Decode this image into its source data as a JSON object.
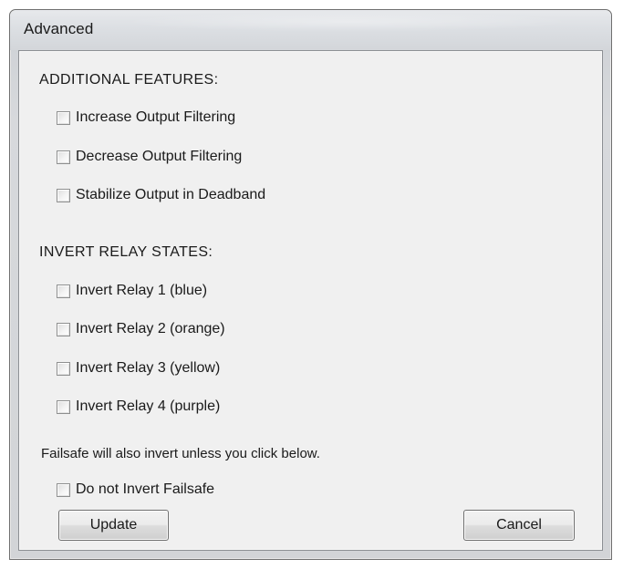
{
  "window": {
    "title": "Advanced"
  },
  "sections": {
    "additional_features": {
      "header": "ADDITIONAL FEATURES:",
      "options": [
        {
          "label": "Increase Output Filtering",
          "checked": false
        },
        {
          "label": "Decrease Output Filtering",
          "checked": false
        },
        {
          "label": "Stabilize Output in Deadband",
          "checked": false
        }
      ]
    },
    "invert_relay_states": {
      "header": "INVERT RELAY STATES:",
      "options": [
        {
          "label": "Invert Relay 1 (blue)",
          "checked": false
        },
        {
          "label": "Invert Relay 2 (orange)",
          "checked": false
        },
        {
          "label": "Invert Relay 3 (yellow)",
          "checked": false
        },
        {
          "label": "Invert Relay 4 (purple)",
          "checked": false
        }
      ]
    },
    "failsafe": {
      "note": "Failsafe will also invert unless you click below.",
      "option": {
        "label": "Do not Invert Failsafe",
        "checked": false
      }
    }
  },
  "buttons": {
    "update": "Update",
    "cancel": "Cancel"
  },
  "colors": {
    "window_frame": "#d2d4d7",
    "client_background": "#f0f0f0",
    "text": "#1a1a1a"
  }
}
